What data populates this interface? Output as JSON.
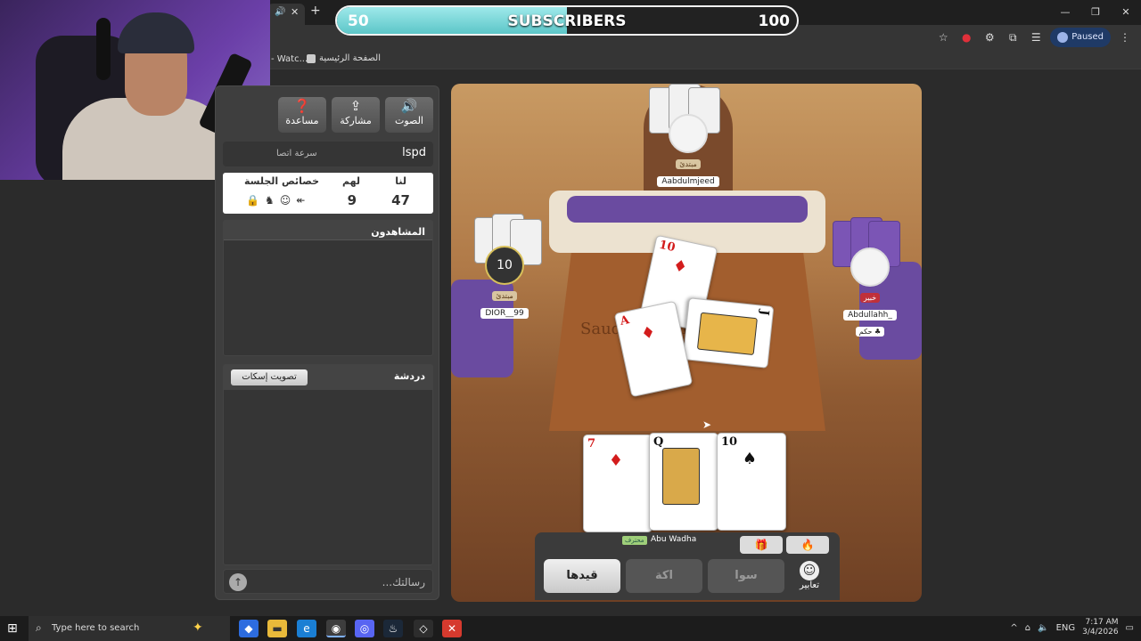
{
  "stream_overlay": {
    "sub_current": "50",
    "sub_label": "SUBSCRIBERS",
    "sub_goal": "100",
    "sub_progress_percent": 50
  },
  "browser": {
    "tab_close": "✕",
    "new_tab": "+",
    "profile_status": "Paused",
    "bookmarks": [
      {
        "label": "- Watc..."
      },
      {
        "label": "الصفحة الرئيسية"
      }
    ],
    "window_controls": [
      "—",
      "❐",
      "✕"
    ]
  },
  "sidebar": {
    "buttons": [
      {
        "label": "مساعدة",
        "icon": "question-icon"
      },
      {
        "label": "مشاركة",
        "icon": "share-icon"
      },
      {
        "label": "الصوت",
        "icon": "speaker-icon"
      }
    ],
    "speed_label": "سرعة اتصا",
    "speed_value": "lspd",
    "score": {
      "us_label": "لنا",
      "them_label": "لهم",
      "props_label": "خصائص الجلسة",
      "us_value": "47",
      "them_value": "9",
      "props_icons": [
        "lock-icon",
        "horse-icon",
        "smiley-icon",
        "arrows-icon"
      ]
    },
    "viewers_title": "المشاهدون",
    "chat_title": "دردشة",
    "mute_button": "تصويت إسكات",
    "message_placeholder": "...رسالتك"
  },
  "game": {
    "players": [
      {
        "name": "Aabdulmjeed",
        "badge": "مبتدئ"
      },
      {
        "name": "DIOR__99",
        "badge": "مبتدئ",
        "timer": "10"
      },
      {
        "name": "Abdullahh_",
        "badge": "خبير",
        "note": "حكم ♣"
      }
    ],
    "table_text": "Saudi Founding Day",
    "table_cards": [
      {
        "rank": "10",
        "suit": "♦",
        "color": "red"
      },
      {
        "rank": "J",
        "suit": "♣",
        "color": "black"
      },
      {
        "rank": "A",
        "suit": "♦",
        "color": "red"
      }
    ],
    "hand": [
      {
        "rank": "7",
        "suit": "♦",
        "color": "red"
      },
      {
        "rank": "Q",
        "suit": "♠",
        "color": "black"
      },
      {
        "rank": "10",
        "suit": "♠",
        "color": "black"
      }
    ],
    "me": {
      "name": "Abu Wadha",
      "badge": "محترف"
    },
    "controls": {
      "qaydha": "قيدها",
      "akka": "اكة",
      "sawa": "سوا",
      "emote": "تعابير"
    }
  },
  "taskbar": {
    "search_placeholder": "Type here to search",
    "language": "ENG",
    "time": "7:17 AM",
    "date": "3/4/2026"
  }
}
